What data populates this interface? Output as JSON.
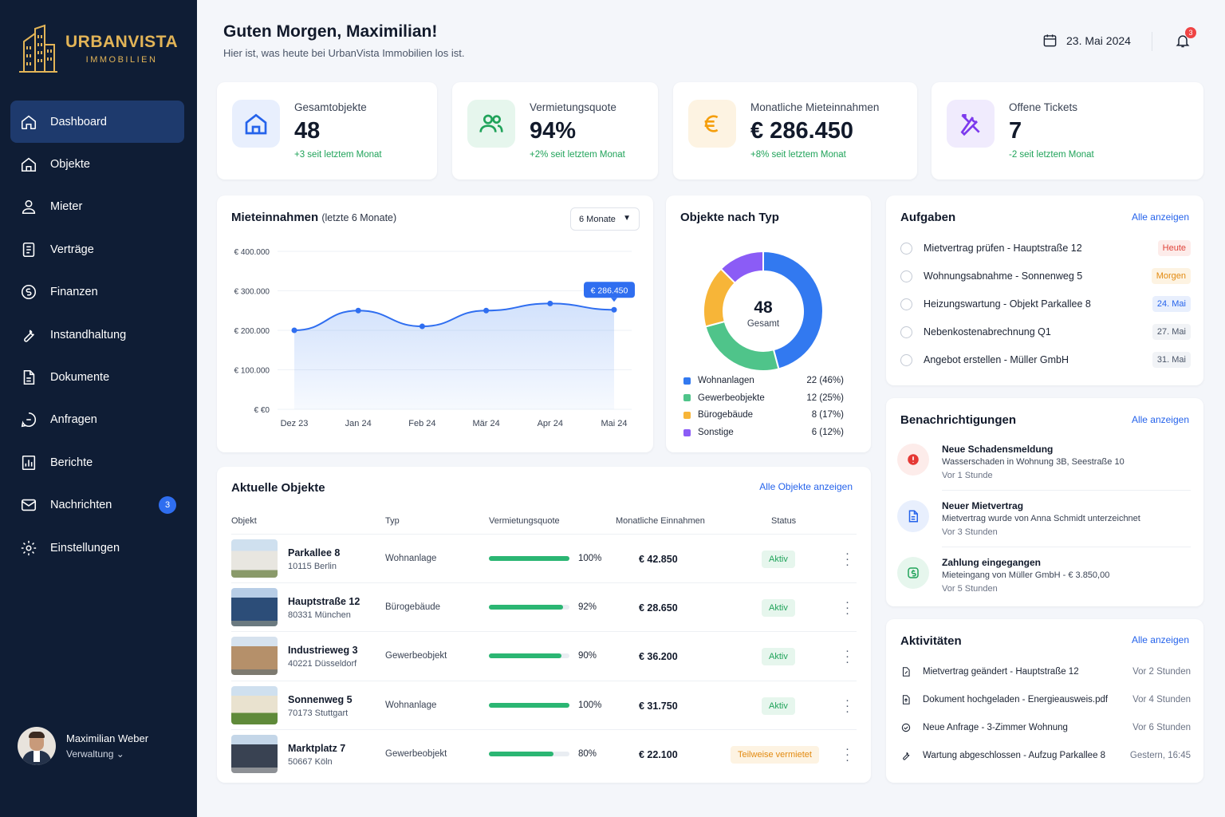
{
  "brand": {
    "name": "URBANVISTA",
    "sub": "IMMOBILIEN"
  },
  "nav": [
    {
      "label": "Dashboard",
      "icon": "home-icon",
      "active": true
    },
    {
      "label": "Objekte",
      "icon": "building-icon"
    },
    {
      "label": "Mieter",
      "icon": "user-icon"
    },
    {
      "label": "Verträge",
      "icon": "contract-icon"
    },
    {
      "label": "Finanzen",
      "icon": "coin-icon"
    },
    {
      "label": "Instandhaltung",
      "icon": "wrench-icon"
    },
    {
      "label": "Dokumente",
      "icon": "document-icon"
    },
    {
      "label": "Anfragen",
      "icon": "inquiry-icon"
    },
    {
      "label": "Berichte",
      "icon": "report-icon"
    },
    {
      "label": "Nachrichten",
      "icon": "mail-icon",
      "badge": "3"
    },
    {
      "label": "Einstellungen",
      "icon": "gear-icon"
    }
  ],
  "user": {
    "name": "Maximilian Weber",
    "role": "Verwaltung ⌄"
  },
  "header": {
    "greeting": "Guten Morgen, Maximilian!",
    "subtitle": "Hier ist, was heute bei UrbanVista Immobilien los ist.",
    "date": "23. Mai 2024",
    "notif_count": "3"
  },
  "kpis": [
    {
      "label": "Gesamtobjekte",
      "value": "48",
      "change": "+3 seit letztem Monat",
      "icon": "building-icon",
      "accent": "#2563eb"
    },
    {
      "label": "Vermietungsquote",
      "value": "94%",
      "change": "+2% seit letztem Monat",
      "icon": "users-icon",
      "accent": "#20a35a"
    },
    {
      "label": "Monatliche Mieteinnahmen",
      "value": "€ 286.450",
      "change": "+8% seit letztem Monat",
      "icon": "euro-icon",
      "accent": "#f59e0b"
    },
    {
      "label": "Offene Tickets",
      "value": "7",
      "change": "-2 seit letztem Monat",
      "icon": "tools-icon",
      "accent": "#7c3aed"
    }
  ],
  "revenue": {
    "title": "Mieteinnahmen",
    "title_suffix": "(letzte 6 Monate)",
    "select": "6 Monate",
    "highlight": "€ 286.450"
  },
  "chart_data": [
    {
      "type": "area",
      "title": "Mieteinnahmen (letzte 6 Monate)",
      "categories": [
        "Dez 23",
        "Jan 24",
        "Feb 24",
        "Mär 24",
        "Apr 24",
        "Mai 24"
      ],
      "values": [
        200000,
        250000,
        210000,
        250000,
        268000,
        252000
      ],
      "ylim": [
        0,
        400000
      ],
      "yticks": [
        "€ 400.000",
        "€ 300.000",
        "€ 200.000",
        "€ 100.000",
        "€ €0"
      ],
      "grid": true,
      "color": "#2f6ef0"
    },
    {
      "type": "pie",
      "title": "Objekte nach Typ",
      "center_value": "48",
      "center_label": "Gesamt",
      "categories": [
        "Wohnanlagen",
        "Gewerbeobjekte",
        "Bürogebäude",
        "Sonstige"
      ],
      "values": [
        22,
        12,
        8,
        6
      ],
      "labels": [
        "22 (46%)",
        "12 (25%)",
        "8 (17%)",
        "6 (12%)"
      ],
      "colors": [
        "#3279f0",
        "#4fc48a",
        "#f7b538",
        "#8b5cf6"
      ]
    }
  ],
  "tasks": {
    "title": "Aufgaben",
    "link": "Alle anzeigen",
    "items": [
      {
        "text": "Mietvertrag prüfen - Hauptstraße 12",
        "tag": "Heute",
        "tag_color": "#e0443b",
        "tag_bg": "#fdecea"
      },
      {
        "text": "Wohnungsabnahme - Sonnenweg 5",
        "tag": "Morgen",
        "tag_color": "#e28a10",
        "tag_bg": "#fdf3e2"
      },
      {
        "text": "Heizungswartung - Objekt Parkallee 8",
        "tag": "24. Mai",
        "tag_color": "#2563eb",
        "tag_bg": "#e8effd"
      },
      {
        "text": "Nebenkostenabrechnung Q1",
        "tag": "27. Mai",
        "tag_color": "#4a5568",
        "tag_bg": "#f1f3f6"
      },
      {
        "text": "Angebot erstellen - Müller GmbH",
        "tag": "31. Mai",
        "tag_color": "#4a5568",
        "tag_bg": "#f1f3f6"
      }
    ]
  },
  "notifications": {
    "title": "Benachrichtigungen",
    "link": "Alle anzeigen",
    "items": [
      {
        "title": "Neue Schadensmeldung",
        "text": "Wasserschaden in Wohnung 3B, Seestraße 10",
        "time": "Vor 1 Stunde",
        "icon": "alert-icon",
        "color": "#e53935",
        "bg": "#fdecea"
      },
      {
        "title": "Neuer Mietvertrag",
        "text": "Mietvertrag wurde von Anna Schmidt unterzeichnet",
        "time": "Vor 3 Stunden",
        "icon": "document-icon",
        "color": "#2563eb",
        "bg": "#e8effd"
      },
      {
        "title": "Zahlung eingegangen",
        "text": "Mieteingang von Müller GmbH - € 3.850,00",
        "time": "Vor 5 Stunden",
        "icon": "payment-icon",
        "color": "#20a35a",
        "bg": "#e6f6ed"
      }
    ]
  },
  "activities": {
    "title": "Aktivitäten",
    "link": "Alle anzeigen",
    "items": [
      {
        "text": "Mietvertrag geändert - Hauptstraße 12",
        "time": "Vor 2 Stunden",
        "icon": "edit-doc-icon"
      },
      {
        "text": "Dokument hochgeladen - Energieausweis.pdf",
        "time": "Vor 4 Stunden",
        "icon": "upload-doc-icon"
      },
      {
        "text": "Neue Anfrage - 3-Zimmer Wohnung",
        "time": "Vor 6 Stunden",
        "icon": "message-icon"
      },
      {
        "text": "Wartung abgeschlossen - Aufzug Parkallee 8",
        "time": "Gestern, 16:45",
        "icon": "wrench-icon"
      }
    ]
  },
  "objects": {
    "title": "Aktuelle Objekte",
    "link": "Alle Objekte anzeigen",
    "columns": [
      "Objekt",
      "Typ",
      "Vermietungsquote",
      "Monatliche Einnahmen",
      "Status"
    ],
    "rows": [
      {
        "name": "Parkallee 8",
        "city": "10115 Berlin",
        "type": "Wohnanlage",
        "rate": 100,
        "rate_label": "100%",
        "income": "€ 42.850",
        "status": "Aktiv",
        "status_color": "#20a35a",
        "status_bg": "#e6f6ed"
      },
      {
        "name": "Hauptstraße 12",
        "city": "80331 München",
        "type": "Bürogebäude",
        "rate": 92,
        "rate_label": "92%",
        "income": "€ 28.650",
        "status": "Aktiv",
        "status_color": "#20a35a",
        "status_bg": "#e6f6ed"
      },
      {
        "name": "Industrieweg 3",
        "city": "40221 Düsseldorf",
        "type": "Gewerbeobjekt",
        "rate": 90,
        "rate_label": "90%",
        "income": "€ 36.200",
        "status": "Aktiv",
        "status_color": "#20a35a",
        "status_bg": "#e6f6ed"
      },
      {
        "name": "Sonnenweg 5",
        "city": "70173 Stuttgart",
        "type": "Wohnanlage",
        "rate": 100,
        "rate_label": "100%",
        "income": "€ 31.750",
        "status": "Aktiv",
        "status_color": "#20a35a",
        "status_bg": "#e6f6ed"
      },
      {
        "name": "Marktplatz 7",
        "city": "50667 Köln",
        "type": "Gewerbeobjekt",
        "rate": 80,
        "rate_label": "80%",
        "income": "€ 22.100",
        "status": "Teilweise vermietet",
        "status_color": "#e28a10",
        "status_bg": "#fdf3e2"
      }
    ]
  }
}
